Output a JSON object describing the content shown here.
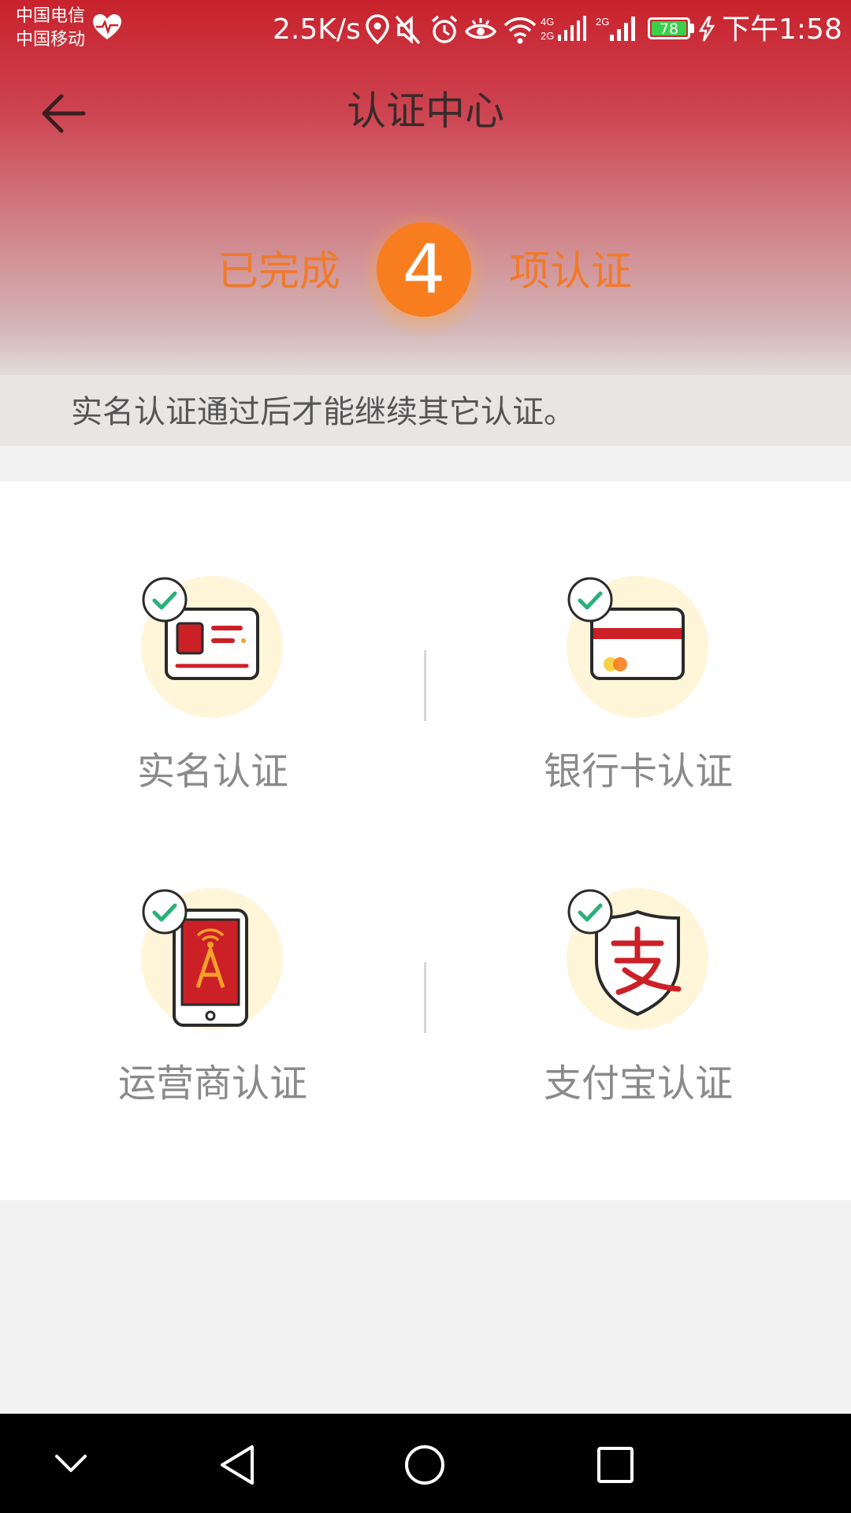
{
  "status_bar": {
    "carrier_1": "中国电信",
    "carrier_2": "中国移动",
    "net_speed": "2.5K/s",
    "net_4g_label": "4G",
    "net_2g_label": "2G",
    "net_2g_label_b": "2G",
    "battery": "78",
    "time": "下午1:58",
    "icons": [
      "heart-pulse-icon",
      "location-icon",
      "mute-icon",
      "alarm-icon",
      "eye-icon",
      "wifi-icon",
      "signal-4g-2g-icon",
      "signal-2g-icon",
      "battery-icon",
      "charging-icon"
    ]
  },
  "header": {
    "title": "认证中心",
    "summary_prefix": "已完成",
    "completed_count": "4",
    "summary_suffix": "项认证"
  },
  "notice": "实名认证通过后才能继续其它认证。",
  "auth_items": [
    {
      "label": "实名认证",
      "icon": "id-card-icon",
      "verified": true
    },
    {
      "label": "银行卡认证",
      "icon": "bank-card-icon",
      "verified": true
    },
    {
      "label": "运营商认证",
      "icon": "carrier-phone-icon",
      "verified": true
    },
    {
      "label": "支付宝认证",
      "icon": "alipay-shield-icon",
      "verified": true
    }
  ],
  "colors": {
    "header_red": "#c8222c",
    "accent_orange": "#f87d1f",
    "check_green": "#2ab07a",
    "icon_bg": "#fff5d9"
  },
  "nav_bar": {
    "icons": [
      "collapse-icon",
      "back-triangle-icon",
      "home-circle-icon",
      "recents-square-icon"
    ]
  }
}
